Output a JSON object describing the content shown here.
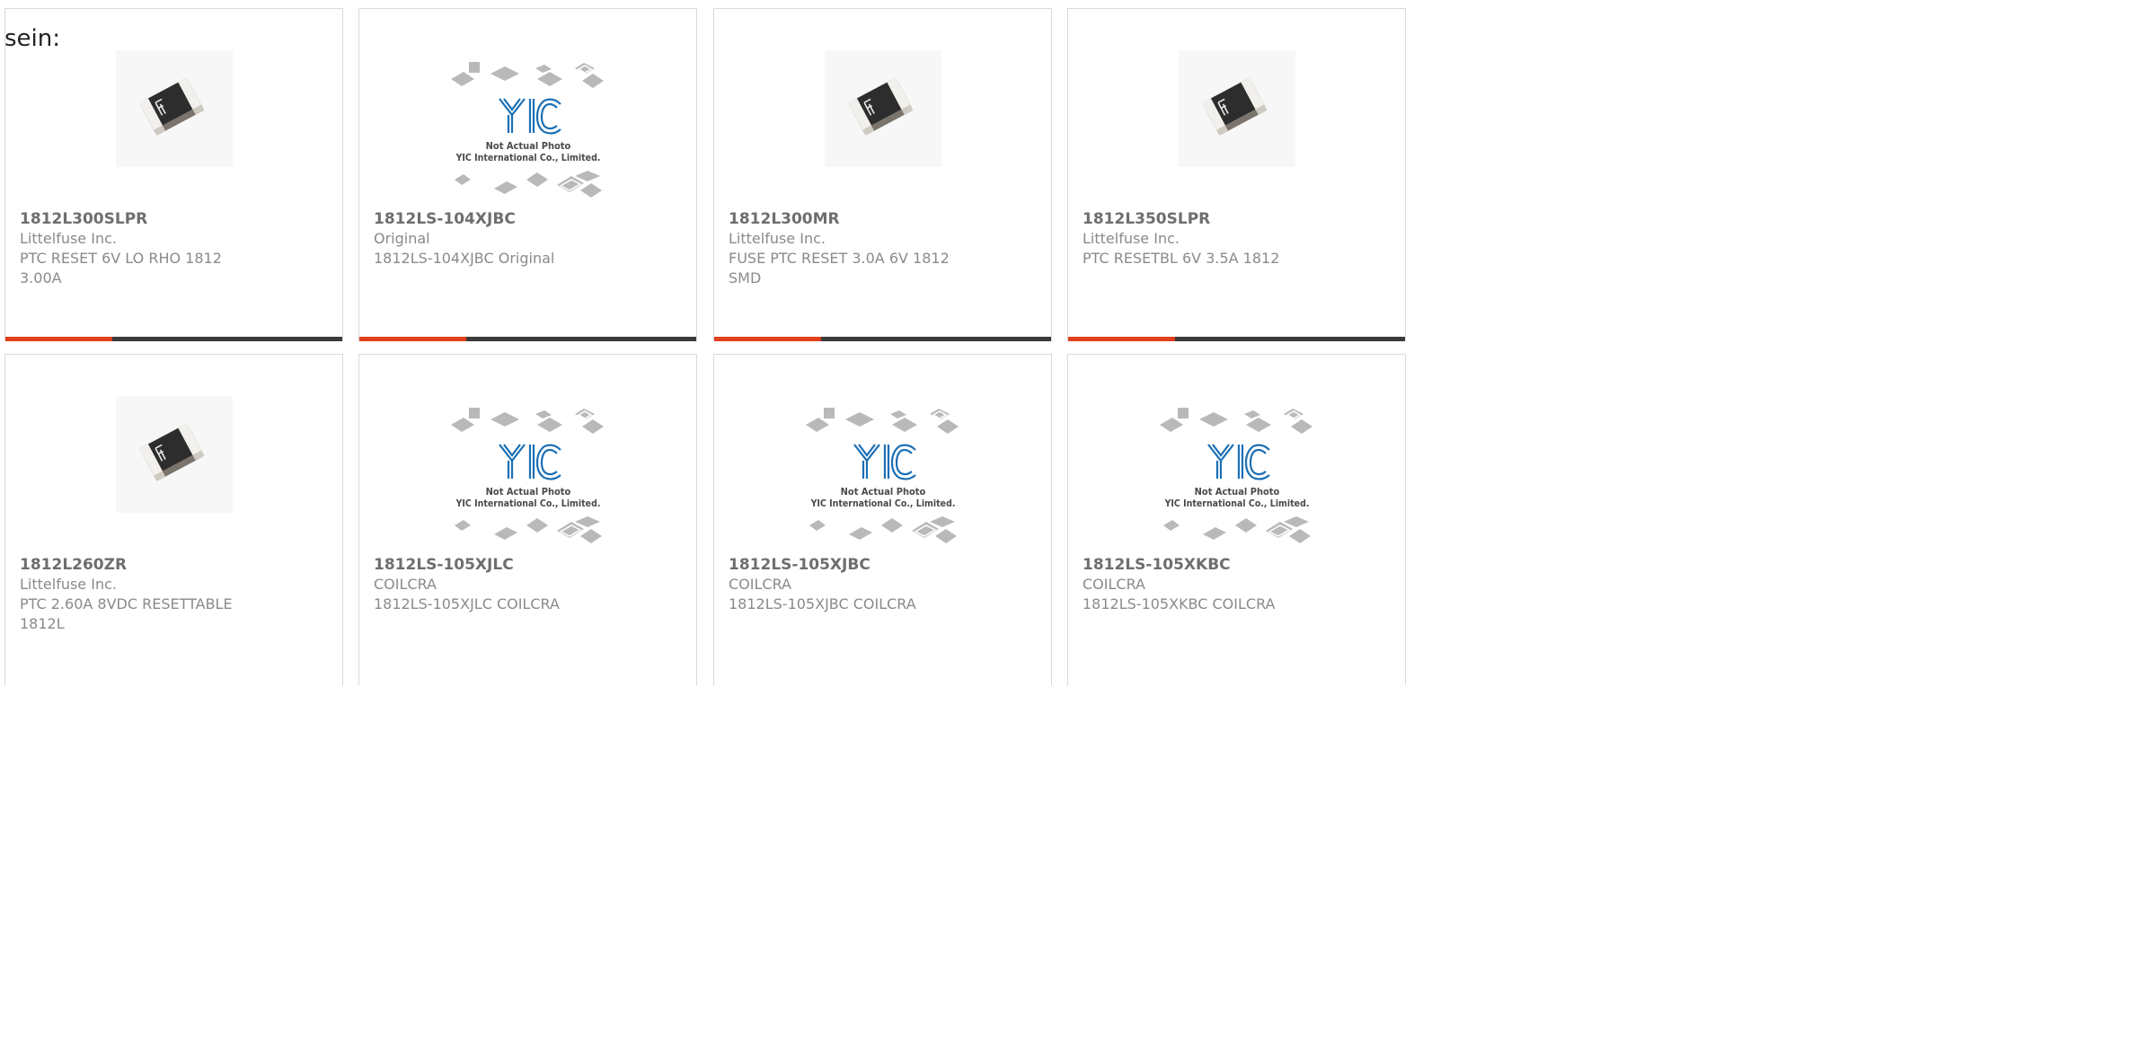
{
  "lead_text": "sein:",
  "colors": {
    "accent": "#e0401d",
    "bar": "#3a3a3a",
    "part_number": "#6e6e6e",
    "text": "#8a8a8a",
    "yic_blue": "#1b6fb5"
  },
  "placeholder": {
    "line1": "Not Actual Photo",
    "line2": "YIC International Co., Limited.",
    "logo": "YIC"
  },
  "products": [
    {
      "part_number": "1812L300SLPR",
      "manufacturer": "Littelfuse Inc.",
      "description_line1": "PTC RESET 6V LO RHO 1812",
      "description_line2": "3.00A",
      "image": "chip-photo"
    },
    {
      "part_number": "1812LS-104XJBC",
      "manufacturer": "Original",
      "description_line1": "1812LS-104XJBC Original",
      "description_line2": "",
      "image": "not-actual-photo"
    },
    {
      "part_number": "1812L300MR",
      "manufacturer": "Littelfuse Inc.",
      "description_line1": "FUSE PTC RESET 3.0A 6V 1812",
      "description_line2": "SMD",
      "image": "chip-photo"
    },
    {
      "part_number": "1812L350SLPR",
      "manufacturer": "Littelfuse Inc.",
      "description_line1": "PTC RESETBL 6V 3.5A 1812",
      "description_line2": "",
      "image": "chip-photo"
    },
    {
      "part_number": "1812L260ZR",
      "manufacturer": "Littelfuse Inc.",
      "description_line1": "PTC 2.60A 8VDC RESETTABLE",
      "description_line2": "1812L",
      "image": "chip-photo"
    },
    {
      "part_number": "1812LS-105XJLC",
      "manufacturer": "COILCRA",
      "description_line1": "1812LS-105XJLC COILCRA",
      "description_line2": "",
      "image": "not-actual-photo"
    },
    {
      "part_number": "1812LS-105XJBC",
      "manufacturer": "COILCRA",
      "description_line1": "1812LS-105XJBC COILCRA",
      "description_line2": "",
      "image": "not-actual-photo"
    },
    {
      "part_number": "1812LS-105XKBC",
      "manufacturer": "COILCRA",
      "description_line1": "1812LS-105XKBC COILCRA",
      "description_line2": "",
      "image": "not-actual-photo"
    }
  ]
}
